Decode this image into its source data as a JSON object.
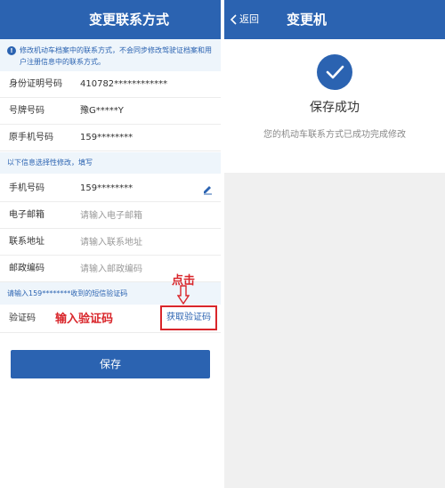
{
  "left": {
    "title": "变更联系方式",
    "notice": "修改机动车档案中的联系方式，不会同步修改驾驶证档案和用户注册信息中的联系方式。",
    "fixed_rows": [
      {
        "label": "身份证明号码",
        "value": "410782************"
      },
      {
        "label": "号牌号码",
        "value": "豫G*****Y"
      },
      {
        "label": "原手机号码",
        "value": "159********"
      }
    ],
    "optional_section": "以下信息选择性修改，填写",
    "phone": {
      "label": "手机号码",
      "value": "159********"
    },
    "email": {
      "label": "电子邮箱",
      "placeholder": "请输入电子邮箱"
    },
    "address": {
      "label": "联系地址",
      "placeholder": "请输入联系地址"
    },
    "postcode": {
      "label": "邮政编码",
      "placeholder": "请输入邮政编码"
    },
    "sms_hint": "请输入159********收到的短信验证码",
    "code_label": "验证码",
    "get_code": "获取验证码",
    "save": "保存",
    "annotation_input": "输入验证码",
    "annotation_click": "点击"
  },
  "right": {
    "back": "返回",
    "title": "变更机",
    "success_title": "保存成功",
    "success_message": "您的机动车联系方式已成功完成修改"
  },
  "colors": {
    "primary": "#2b63b1",
    "annotation": "#d9262b",
    "notice_bg": "#eef5fb"
  }
}
